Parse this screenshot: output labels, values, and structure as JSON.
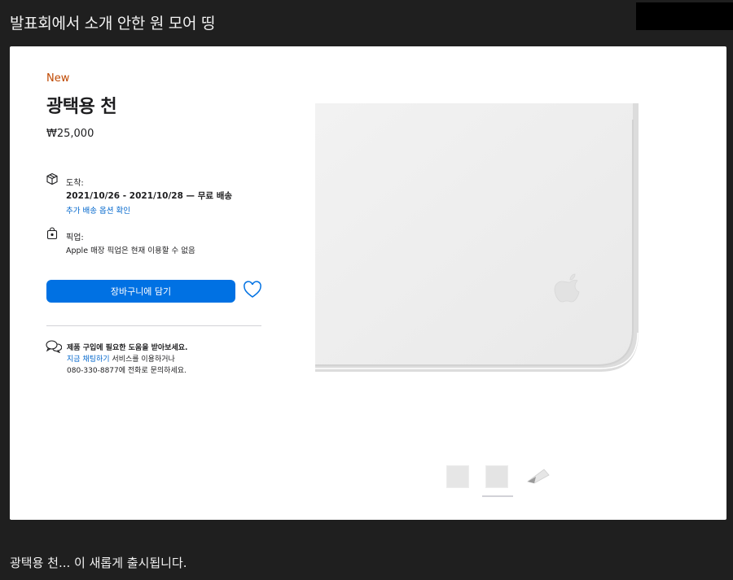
{
  "post": {
    "title": "발표회에서 소개 안한 원 모어 띵",
    "caption": "광택용 천... 이 새롭게 출시됩니다."
  },
  "product": {
    "badge": "New",
    "name": "광택용 천",
    "price": "₩25,000",
    "delivery": {
      "label": "도착:",
      "dates": "2021/10/26 - 2021/10/28 — 무료 배송",
      "link": "추가 배송 옵션 확인"
    },
    "pickup": {
      "label": "픽업:",
      "status": "Apple 매장 픽업은 현재 이용할 수 없음"
    },
    "add_to_bag": "장바구니에 담기",
    "help": {
      "title": "제품 구입에 필요한 도움을 받아보세요.",
      "link": "지금 채팅하기",
      "line2_rest": " 서비스를 이용하거나",
      "line3": "080-330-8877에 전화로 문의하세요."
    }
  },
  "colors": {
    "accent": "#0071e3",
    "new_badge": "#bf4800",
    "link": "#0066cc",
    "background": "#1f1f1f"
  },
  "icons": [
    "box-icon",
    "bag-icon",
    "heart-icon",
    "chat-icon",
    "apple-logo-icon"
  ],
  "thumbnails": {
    "count": 3,
    "selected": 2
  }
}
